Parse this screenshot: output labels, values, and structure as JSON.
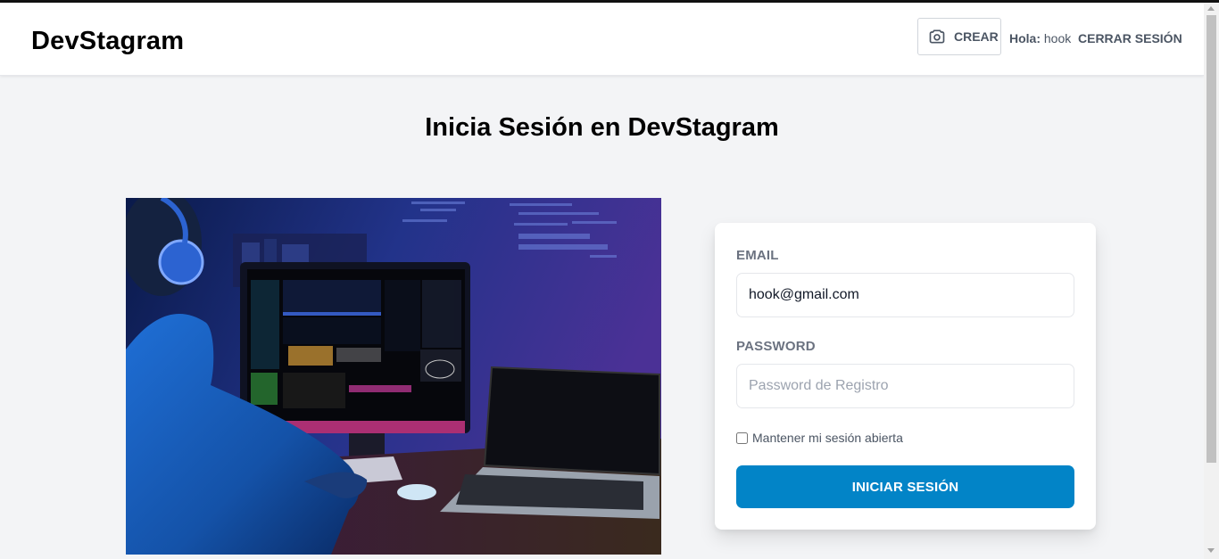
{
  "header": {
    "logo": "DevStagram",
    "crear_label": "CREAR",
    "greeting_prefix": "Hola:",
    "username": "hook",
    "logout_label": "CERRAR SESIÓN"
  },
  "page": {
    "title": "Inicia Sesión en DevStagram"
  },
  "form": {
    "email_label": "EMAIL",
    "email_value": "hook@gmail.com",
    "password_label": "PASSWORD",
    "password_placeholder": "Password de Registro",
    "remember_label": "Mantener mi sesión abierta",
    "remember_checked": false,
    "submit_label": "INICIAR SESIÓN"
  },
  "colors": {
    "primary_button": "#0284c7",
    "page_background": "#f3f4f6"
  },
  "icons": {
    "crear": "camera-icon"
  }
}
